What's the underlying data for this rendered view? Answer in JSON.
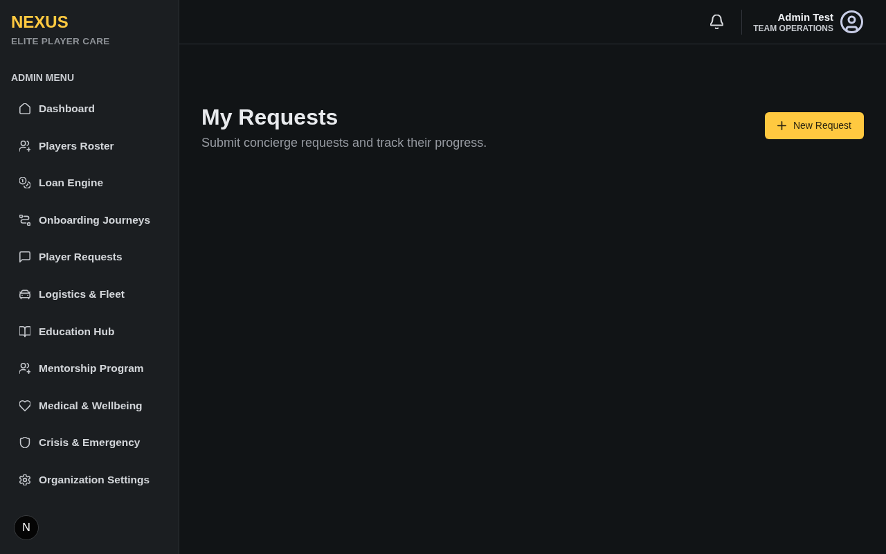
{
  "sidebar": {
    "logo": "NEXUS",
    "tagline": "ELITE PLAYER CARE",
    "section_title": "ADMIN MENU",
    "items": [
      {
        "label": "Dashboard",
        "selected": false
      },
      {
        "label": "Players Roster",
        "selected": false
      },
      {
        "label": "Loan Engine",
        "selected": false
      },
      {
        "label": "Onboarding Journeys",
        "selected": false
      },
      {
        "label": "Player Requests",
        "selected": false
      },
      {
        "label": "Logistics & Fleet",
        "selected": false
      },
      {
        "label": "Education Hub",
        "selected": false
      },
      {
        "label": "Mentorship Program",
        "selected": false
      },
      {
        "label": "Medical & Wellbeing",
        "selected": false
      },
      {
        "label": "Crisis & Emergency",
        "selected": false
      },
      {
        "label": "Organization Settings",
        "selected": false
      }
    ]
  },
  "dev_badge": {
    "label": "N"
  },
  "header": {
    "user": {
      "name": "Admin Test",
      "role": "TEAM OPERATIONS"
    }
  },
  "page": {
    "title": "My Requests",
    "subtitle": "Submit concierge requests and track their progress.",
    "new_button": {
      "label": "New Request"
    }
  }
}
